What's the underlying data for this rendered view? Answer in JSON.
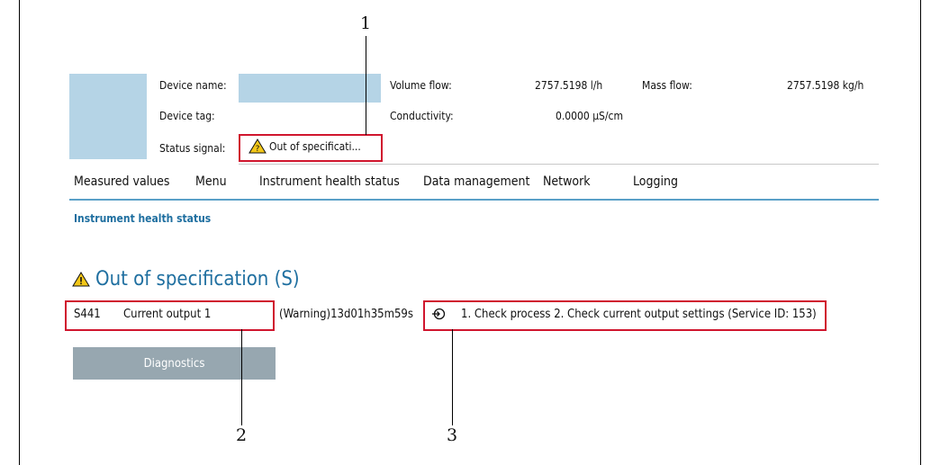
{
  "header": {
    "device_name_label": "Device name:",
    "device_tag_label": "Device tag:",
    "status_signal_label": "Status signal:",
    "status_signal_value": "Out of specificati...",
    "volume_flow_label": "Volume flow:",
    "volume_flow_value": "2757.5198 l/h",
    "mass_flow_label": "Mass flow:",
    "mass_flow_value": "2757.5198 kg/h",
    "conductivity_label": "Conductivity:",
    "conductivity_value": "0.0000 µS/cm"
  },
  "tabs": [
    "Measured values",
    "Menu",
    "Instrument health status",
    "Data management",
    "Network",
    "Logging"
  ],
  "breadcrumb": "Instrument health status",
  "main": {
    "headline": "Out of specification (S)",
    "diag_code": "S441",
    "diag_name": "Current output 1",
    "diag_time": "(Warning)13d01h35m59s",
    "remedy": "1. Check process 2. Check current output settings (Service ID: 153)",
    "diagnostics_button": "Diagnostics"
  },
  "callouts": [
    "1",
    "2",
    "3"
  ],
  "colors": {
    "highlight": "#d0162e",
    "accent": "#1f6fa0",
    "placeholder": "#b5d4e6",
    "button": "#97a7b0"
  }
}
